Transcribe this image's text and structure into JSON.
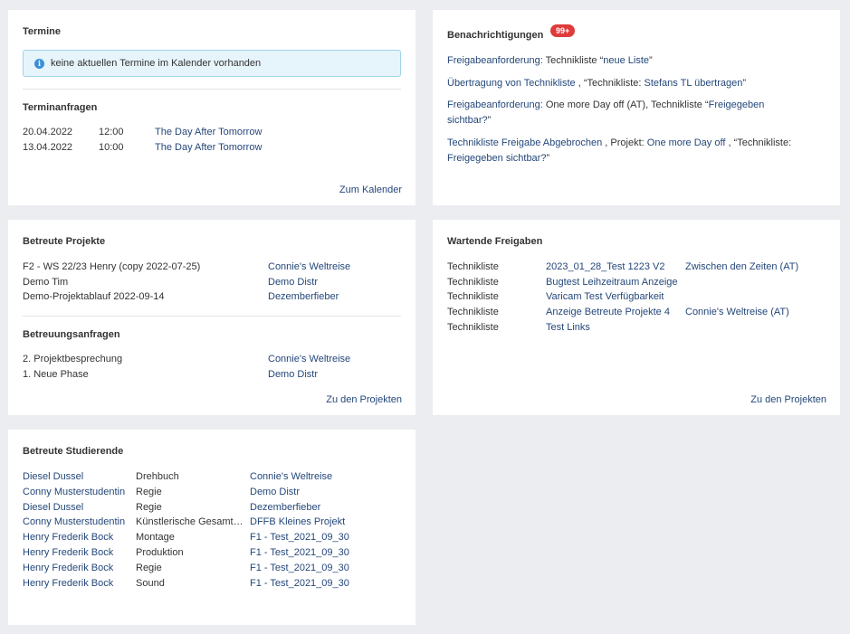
{
  "termine": {
    "title": "Termine",
    "info": "keine aktuellen Termine im Kalender vorhanden",
    "requests_title": "Terminanfragen",
    "requests": [
      {
        "date": "20.04.2022",
        "time": "12:00",
        "event": "The Day After Tomorrow"
      },
      {
        "date": "13.04.2022",
        "time": "10:00",
        "event": "The Day After Tomorrow"
      }
    ],
    "footer_link": "Zum Kalender"
  },
  "benachrichtigungen": {
    "title": "Benachrichtigungen",
    "badge": "99+",
    "items": [
      {
        "l1": [
          {
            "t": "Freigabeanforderung:",
            "link": true
          },
          {
            "t": " Technikliste “",
            "link": false
          },
          {
            "t": "neue Liste",
            "link": true
          },
          {
            "t": "”",
            "link": false
          }
        ]
      },
      {
        "l1": [
          {
            "t": "Übertragung von Technikliste",
            "link": true
          },
          {
            "t": " , “Technikliste: ",
            "link": false
          },
          {
            "t": "Stefans TL übertragen",
            "link": true
          },
          {
            "t": "”",
            "link": false
          }
        ]
      },
      {
        "l1": [
          {
            "t": "Freigabeanforderung:",
            "link": true
          },
          {
            "t": " One more Day off (AT), Technikliste “",
            "link": false
          },
          {
            "t": "Freigegeben",
            "link": true
          }
        ],
        "l2": [
          {
            "t": "sichtbar?",
            "link": true
          },
          {
            "t": "”",
            "link": false
          }
        ]
      },
      {
        "l1": [
          {
            "t": "Technikliste Freigabe Abgebrochen",
            "link": true
          },
          {
            "t": " , Projekt: ",
            "link": false
          },
          {
            "t": "One more Day off",
            "link": true
          },
          {
            "t": " , “Technikliste:",
            "link": false
          }
        ],
        "l2": [
          {
            "t": "Freigegeben sichtbar?",
            "link": true
          },
          {
            "t": "”",
            "link": false
          }
        ]
      }
    ]
  },
  "projekte": {
    "title": "Betreute Projekte",
    "rows": [
      {
        "name": "F2 - WS 22/23 Henry (copy 2022-07-25)",
        "project": "Connie's Weltreise"
      },
      {
        "name": "Demo Tim",
        "project": "Demo Distr"
      },
      {
        "name": "Demo-Projektablauf 2022-09-14",
        "project": "Dezemberfieber"
      }
    ],
    "requests_title": "Betreuungsanfragen",
    "requests": [
      {
        "name": "2. Projektbesprechung",
        "project": "Connie's Weltreise"
      },
      {
        "name": "1. Neue Phase",
        "project": "Demo Distr"
      }
    ],
    "footer_link": "Zu den Projekten"
  },
  "freigaben": {
    "title": "Wartende Freigaben",
    "rows": [
      {
        "type": "Technikliste",
        "item": "2023_01_28_Test 1223 V2",
        "project": "Zwischen den Zeiten (AT)"
      },
      {
        "type": "Technikliste",
        "item": "Bugtest Leihzeitraum Anzeige",
        "project": ""
      },
      {
        "type": "Technikliste",
        "item": "Varicam Test Verfügbarkeit",
        "project": ""
      },
      {
        "type": "Technikliste",
        "item": "Anzeige Betreute Projekte 4",
        "project": "Connie's Weltreise (AT)"
      },
      {
        "type": "Technikliste",
        "item": "Test Links",
        "project": ""
      }
    ],
    "footer_link": "Zu den Projekten"
  },
  "studierende": {
    "title": "Betreute Studierende",
    "rows": [
      {
        "student": "Diesel Dussel",
        "role": "Drehbuch",
        "project": "Connie's Weltreise"
      },
      {
        "student": "Conny Musterstudentin",
        "role": "Regie",
        "project": "Demo Distr"
      },
      {
        "student": "Diesel Dussel",
        "role": "Regie",
        "project": "Dezemberfieber"
      },
      {
        "student": "Conny Musterstudentin",
        "role": "Künstlerische Gesamt…",
        "project": "DFFB Kleines Projekt"
      },
      {
        "student": "Henry Frederik Bock",
        "role": "Montage",
        "project": "F1 - Test_2021_09_30"
      },
      {
        "student": "Henry Frederik Bock",
        "role": "Produktion",
        "project": "F1 - Test_2021_09_30"
      },
      {
        "student": "Henry Frederik Bock",
        "role": "Regie",
        "project": "F1 - Test_2021_09_30"
      },
      {
        "student": "Henry Frederik Bock",
        "role": "Sound",
        "project": "F1 - Test_2021_09_30"
      }
    ]
  }
}
